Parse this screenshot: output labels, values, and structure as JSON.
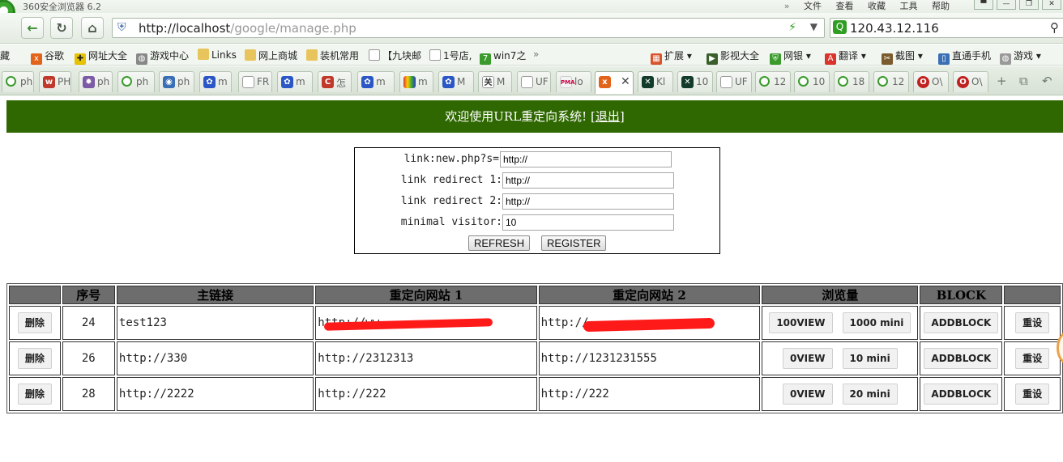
{
  "browser": {
    "title": "360安全浏览器 6.2",
    "menu": [
      "文件",
      "查看",
      "收藏",
      "工具",
      "帮助"
    ],
    "url_host": "http://localhost",
    "url_path": "/google/manage.php",
    "search_value": "120.43.12.116",
    "bookmarks": [
      "藏",
      "谷歌",
      "网址大全",
      "游戏中心",
      "Links",
      "网上商城",
      "装机常用",
      "【九块邮",
      "1号店,",
      "win7之",
      "扩展",
      "影视大全",
      "网银",
      "翻译",
      "截图",
      "直通手机",
      "游戏"
    ],
    "tabs": [
      "ph",
      "PH",
      "ph",
      "ph",
      "ph",
      "m",
      "FR",
      "m",
      "怎",
      "m",
      "m",
      "M",
      "M",
      "UF",
      "lo",
      "",
      "Kl",
      "10",
      "UF",
      "12",
      "10",
      "18",
      "12",
      "O\\",
      "O\\"
    ],
    "active_tab_index": 15
  },
  "banner": {
    "text": "欢迎使用URL重定向系统! [",
    "logout": "退出",
    "close": "]"
  },
  "form": {
    "fields": [
      {
        "label": "link:new.php?s=",
        "value": "http://"
      },
      {
        "label": "link redirect 1:",
        "value": "http://"
      },
      {
        "label": "link redirect 2:",
        "value": "http://"
      },
      {
        "label": "minimal visitor:",
        "value": "10"
      }
    ],
    "refresh": "REFRESH",
    "register": "REGISTER"
  },
  "table": {
    "headers": [
      "",
      "序号",
      "主链接",
      "重定向网站 1",
      "重定向网站 2",
      "浏览量",
      "BLOCK",
      ""
    ],
    "delete_label": "删除",
    "block_label": "ADDBLOCK",
    "reset_label": "重设",
    "rows": [
      {
        "id": "24",
        "main": "test123",
        "r1": "http://ww",
        "r2": "http://",
        "views": "100VIEW",
        "mini": "1000 mini"
      },
      {
        "id": "26",
        "main": "http://330",
        "r1": "http://2312313",
        "r2": "http://1231231555",
        "views": "0VIEW",
        "mini": "10 mini"
      },
      {
        "id": "28",
        "main": "http://2222",
        "r1": "http://222",
        "r2": "http://222",
        "views": "0VIEW",
        "mini": "20 mini"
      }
    ]
  },
  "colors": {
    "banner_bg": "#2f6800",
    "header_bg": "#6d6d6d",
    "redaction": "#ff1a1a"
  }
}
